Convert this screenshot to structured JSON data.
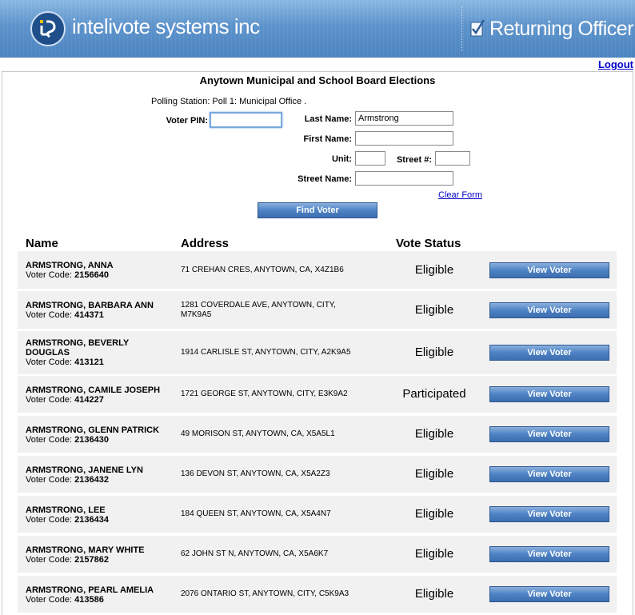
{
  "header": {
    "brand": "intelivote systems inc",
    "role": "Returning Officer"
  },
  "nav": {
    "logout": "Logout"
  },
  "page": {
    "title": "Anytown Municipal and School Board Elections",
    "polling_station": "Polling Station: Poll 1: Municipal Office ."
  },
  "search": {
    "voter_pin_label": "Voter PIN:",
    "voter_pin_value": "",
    "last_name_label": "Last Name:",
    "last_name_value": "Armstrong",
    "first_name_label": "First Name:",
    "first_name_value": "",
    "unit_label": "Unit:",
    "unit_value": "",
    "street_no_label": "Street #:",
    "street_no_value": "",
    "street_name_label": "Street Name:",
    "street_name_value": "",
    "clear_form": "Clear Form",
    "find_voter": "Find Voter"
  },
  "results": {
    "columns": {
      "name": "Name",
      "address": "Address",
      "status": "Vote Status"
    },
    "code_prefix": "Voter Code:",
    "view_button": "View Voter",
    "rows": [
      {
        "name": "ARMSTRONG, ANNA",
        "code": "2156640",
        "address": "71 CREHAN CRES, ANYTOWN, CA, X4Z1B6",
        "status": "Eligible"
      },
      {
        "name": "ARMSTRONG, BARBARA ANN",
        "code": "414371",
        "address": "1281 COVERDALE AVE, ANYTOWN, CITY, M7K9A5",
        "status": "Eligible"
      },
      {
        "name": "ARMSTRONG, BEVERLY DOUGLAS",
        "code": "413121",
        "address": "1914 CARLISLE ST, ANYTOWN, CITY, A2K9A5",
        "status": "Eligible"
      },
      {
        "name": "ARMSTRONG, CAMILE JOSEPH",
        "code": "414227",
        "address": "1721 GEORGE ST, ANYTOWN, CITY, E3K9A2",
        "status": "Participated"
      },
      {
        "name": "ARMSTRONG, GLENN PATRICK",
        "code": "2136430",
        "address": "49 MORISON ST, ANYTOWN, CA, X5A5L1",
        "status": "Eligible"
      },
      {
        "name": "ARMSTRONG, JANENE LYN",
        "code": "2136432",
        "address": "136 DEVON ST, ANYTOWN, CA, X5A2Z3",
        "status": "Eligible"
      },
      {
        "name": "ARMSTRONG, LEE",
        "code": "2136434",
        "address": "184 QUEEN ST, ANYTOWN, CA, X5A4N7",
        "status": "Eligible"
      },
      {
        "name": "ARMSTRONG, MARY WHITE",
        "code": "2157862",
        "address": "62 JOHN ST N, ANYTOWN, CA, X5A6K7",
        "status": "Eligible"
      },
      {
        "name": "ARMSTRONG, PEARL AMELIA",
        "code": "413586",
        "address": "2076 ONTARIO ST, ANYTOWN, CITY, C5K9A3",
        "status": "Eligible"
      }
    ]
  }
}
